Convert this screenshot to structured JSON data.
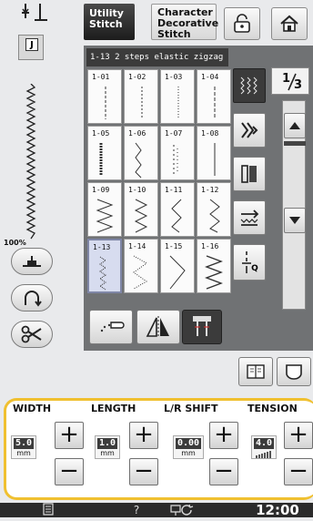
{
  "tabs": {
    "utility": [
      "Utility",
      "Stitch"
    ],
    "character": [
      "Character",
      "Decorative",
      "Stitch"
    ]
  },
  "icons": {
    "lock": "lock-icon",
    "home": "home-icon"
  },
  "left": {
    "presser_foot_letter": "J",
    "zoom_label": "100%"
  },
  "grid": {
    "header": "1-13  2 steps elastic zigzag",
    "cells": [
      "1-01",
      "1-02",
      "1-03",
      "1-04",
      "1-05",
      "1-06",
      "1-07",
      "1-08",
      "1-09",
      "1-10",
      "1-11",
      "1-12",
      "1-13",
      "1-14",
      "1-15",
      "1-16"
    ],
    "selected": "1-13"
  },
  "paging": {
    "current": "1",
    "total": "3"
  },
  "side_q_label": "Q",
  "settings": {
    "width": {
      "label": "WIDTH",
      "value": "5.0",
      "unit": "mm"
    },
    "length": {
      "label": "LENGTH",
      "value": "1.0",
      "unit": "mm"
    },
    "lr_shift": {
      "label": "L/R SHIFT",
      "value": "0.00",
      "unit": "mm"
    },
    "tension": {
      "label": "TENSION",
      "value": "4.0"
    },
    "plus": "+",
    "minus": "−"
  },
  "status": {
    "help": "?",
    "time": "12:00"
  },
  "colors": {
    "highlight_frame": "#f0c030",
    "selected_cell": "#d7dcef"
  }
}
